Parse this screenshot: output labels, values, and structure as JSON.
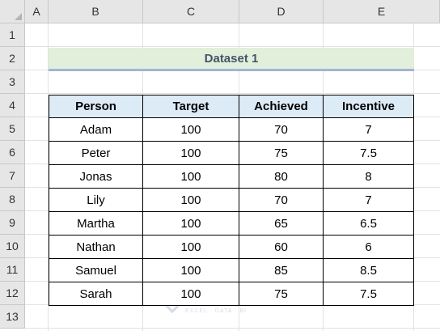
{
  "columns": [
    "A",
    "B",
    "C",
    "D",
    "E"
  ],
  "rows": [
    "1",
    "2",
    "3",
    "4",
    "5",
    "6",
    "7",
    "8",
    "9",
    "10",
    "11",
    "12",
    "13"
  ],
  "dataset_title": "Dataset 1",
  "table": {
    "headers": [
      "Person",
      "Target",
      "Achieved",
      "Incentive"
    ],
    "rows": [
      [
        "Adam",
        "100",
        "70",
        "7"
      ],
      [
        "Peter",
        "100",
        "75",
        "7.5"
      ],
      [
        "Jonas",
        "100",
        "80",
        "8"
      ],
      [
        "Lily",
        "100",
        "70",
        "7"
      ],
      [
        "Martha",
        "100",
        "65",
        "6.5"
      ],
      [
        "Nathan",
        "100",
        "60",
        "6"
      ],
      [
        "Samuel",
        "100",
        "85",
        "8.5"
      ],
      [
        "Sarah",
        "100",
        "75",
        "7.5"
      ]
    ]
  },
  "watermark": {
    "name": "exceldemy",
    "tagline": "EXCEL · DATA · BI"
  },
  "colors": {
    "header_fill": "#ddebf7",
    "title_fill": "#e2efda",
    "title_text": "#44546a"
  }
}
